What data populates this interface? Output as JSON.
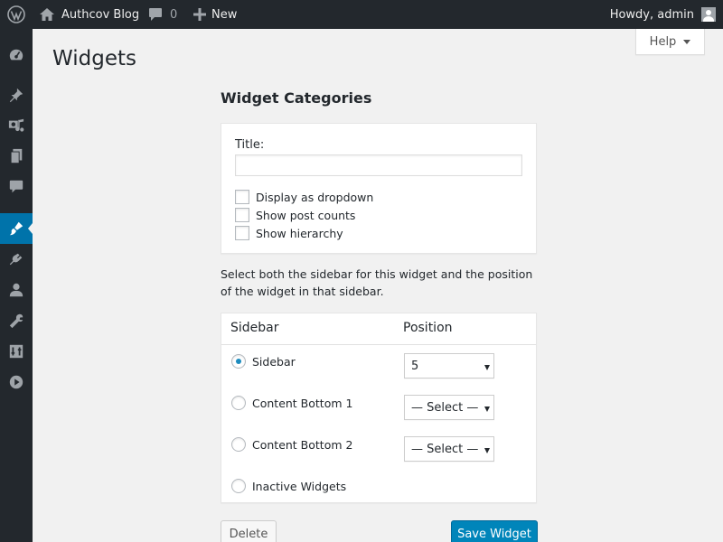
{
  "admin_bar": {
    "site_name": "Authcov Blog",
    "comments_count": "0",
    "new_label": "New",
    "howdy": "Howdy, admin"
  },
  "side_menu": [
    {
      "icon": "dashboard-icon"
    },
    {
      "icon": "pin-icon"
    },
    {
      "icon": "media-icon"
    },
    {
      "icon": "pages-icon"
    },
    {
      "icon": "comments-icon"
    },
    {
      "icon": "appearance-icon",
      "current": true
    },
    {
      "icon": "plugins-icon"
    },
    {
      "icon": "users-icon"
    },
    {
      "icon": "tools-icon"
    },
    {
      "icon": "settings-icon"
    },
    {
      "icon": "media-play-icon"
    }
  ],
  "help_label": "Help",
  "page_title": "Widgets",
  "widget": {
    "title": "Widget Categories",
    "title_field_label": "Title:",
    "title_field_value": "",
    "checkboxes": [
      {
        "label": "Display as dropdown",
        "checked": false
      },
      {
        "label": "Show post counts",
        "checked": false
      },
      {
        "label": "Show hierarchy",
        "checked": false
      }
    ]
  },
  "description": "Select both the sidebar for this widget and the position of the widget in that sidebar.",
  "table": {
    "col_sidebar": "Sidebar",
    "col_position": "Position",
    "rows": [
      {
        "label": "Sidebar",
        "selected": true,
        "position": "5"
      },
      {
        "label": "Content Bottom 1",
        "selected": false,
        "position": "— Select —"
      },
      {
        "label": "Content Bottom 2",
        "selected": false,
        "position": "— Select —"
      },
      {
        "label": "Inactive Widgets",
        "selected": false
      }
    ]
  },
  "buttons": {
    "delete": "Delete",
    "save": "Save Widget"
  },
  "colors": {
    "admin_bar_bg": "#23282d",
    "accent": "#0073aa",
    "primary_button": "#0085ba"
  }
}
